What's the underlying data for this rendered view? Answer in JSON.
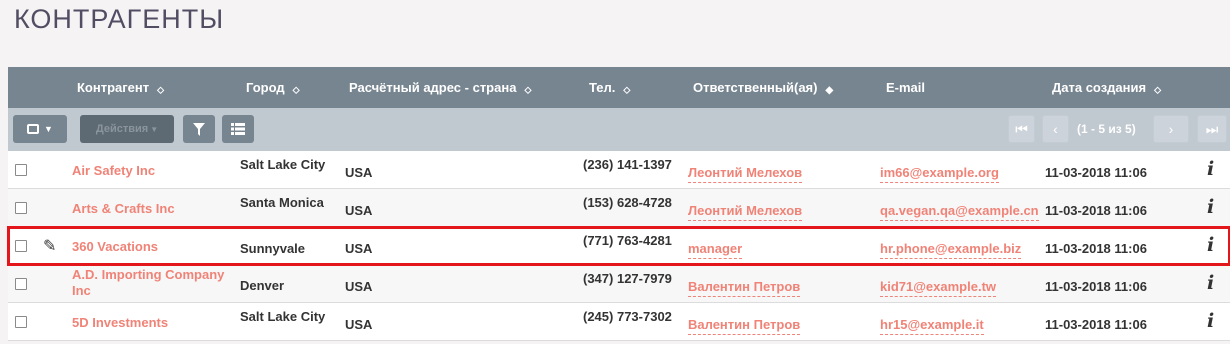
{
  "title": "КОНТРАГЕНТЫ",
  "columns": [
    "Контрагент",
    "Город",
    "Расчётный адрес - страна",
    "Тел.",
    "Ответственный(ая)",
    "E-mail",
    "Дата создания"
  ],
  "toolbar": {
    "actions_label": "Действия",
    "pagination": "(1 - 5 из 5)"
  },
  "icons": {
    "sort": "sort-arrows-icon",
    "filter": "filter-icon",
    "columns": "column-chooser-icon",
    "edit": "pencil-icon",
    "info": "info-icon"
  },
  "rows": [
    {
      "name": "Air Safety Inc",
      "city": "Salt Lake City",
      "country": "USA",
      "phone": "(236) 141-1397",
      "user": "Леонтий Мелехов",
      "email": "im66@example.org",
      "date": "11-03-2018 11:06"
    },
    {
      "name": "Arts & Crafts Inc",
      "city": "Santa Monica",
      "country": "USA",
      "phone": "(153) 628-4728",
      "user": "Леонтий Мелехов",
      "email": "qa.vegan.qa@example.cn",
      "date": "11-03-2018 11:06"
    },
    {
      "name": "360 Vacations",
      "city": "Sunnyvale",
      "country": "USA",
      "phone": "(771) 763-4281",
      "user": "manager",
      "email": "hr.phone@example.biz",
      "date": "11-03-2018 11:06"
    },
    {
      "name": "A.D. Importing Company Inc",
      "city": "Denver",
      "country": "USA",
      "phone": "(347) 127-7979",
      "user": "Валентин Петров",
      "email": "kid71@example.tw",
      "date": "11-03-2018 11:06"
    },
    {
      "name": "5D Investments",
      "city": "Salt Lake City",
      "country": "USA",
      "phone": "(245) 773-7302",
      "user": "Валентин Петров",
      "email": "hr15@example.it",
      "date": "11-03-2018 11:06"
    }
  ]
}
